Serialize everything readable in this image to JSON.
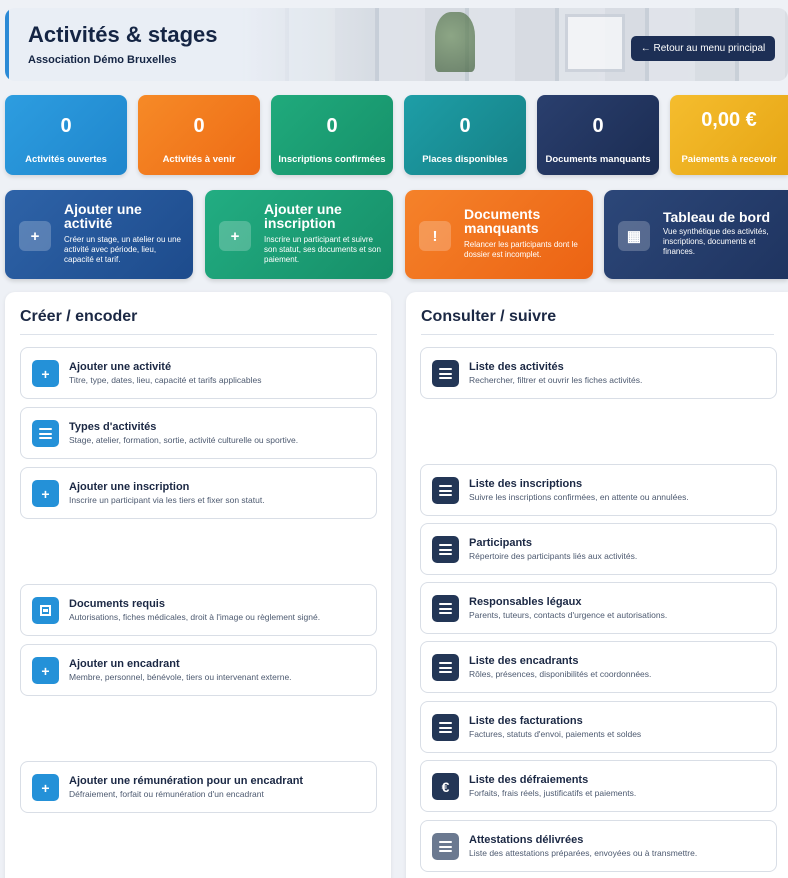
{
  "header": {
    "title": "Activités & stages",
    "subtitle": "Association Démo Bruxelles",
    "back_button": "← Retour au menu principal"
  },
  "stats": [
    {
      "value": "0",
      "label": "Activités ouvertes",
      "color": "#2d9de0"
    },
    {
      "value": "0",
      "label": "Activités à venir",
      "color": "#f68a27"
    },
    {
      "value": "0",
      "label": "Inscriptions confirmées",
      "color": "#20aa7c"
    },
    {
      "value": "0",
      "label": "Places disponibles",
      "color": "#1e9ea7"
    },
    {
      "value": "0",
      "label": "Documents manquants",
      "color": "#2a3f6e"
    },
    {
      "value": "0,00 €",
      "label": "Paiements à recevoir",
      "color": "#f5bd2e"
    }
  ],
  "actions": [
    {
      "icon": "plus-icon",
      "glyph": "+",
      "title": "Ajouter une activité",
      "desc": "Créer un stage, un atelier ou une activité avec période, lieu, capacité et tarif."
    },
    {
      "icon": "plus-icon",
      "glyph": "+",
      "title": "Ajouter une inscription",
      "desc": "Inscrire un participant et suivre son statut, ses documents et son paiement."
    },
    {
      "icon": "alert-icon",
      "glyph": "!",
      "title": "Documents manquants",
      "desc": "Relancer les participants dont le dossier est incomplet."
    },
    {
      "icon": "grid-icon",
      "glyph": "▦",
      "title": "Tableau de bord",
      "desc": "Vue synthétique des activités, inscriptions, documents et finances."
    }
  ],
  "create": {
    "heading": "Créer / encoder",
    "items": [
      {
        "icon": "plus-icon",
        "title": "Ajouter une activité",
        "desc": "Titre, type, dates, lieu, capacité et tarifs applicables"
      },
      {
        "icon": "list-icon",
        "title": "Types d'activités",
        "desc": "Stage, atelier, formation, sortie, activité culturelle ou sportive."
      },
      {
        "icon": "plus-icon",
        "title": "Ajouter une inscription",
        "desc": "Inscrire un participant via les tiers et fixer son statut."
      },
      {
        "icon": "document-icon",
        "title": "Documents requis",
        "desc": "Autorisations, fiches médicales, droit à l'image ou règlement signé."
      },
      {
        "icon": "plus-icon",
        "title": "Ajouter un encadrant",
        "desc": "Membre, personnel, bénévole, tiers ou intervenant externe."
      },
      {
        "icon": "plus-icon",
        "title": "Ajouter une rémunération pour un encadrant",
        "desc": "Défraiement, forfait ou rémunération d'un encadrant"
      }
    ]
  },
  "consult": {
    "heading": "Consulter / suivre",
    "items": [
      {
        "icon": "list-icon",
        "title": "Liste des activités",
        "desc": "Rechercher, filtrer et ouvrir les fiches activités."
      },
      {
        "icon": "list-icon",
        "title": "Liste des inscriptions",
        "desc": "Suivre les inscriptions confirmées, en attente ou annulées."
      },
      {
        "icon": "list-icon",
        "title": "Participants",
        "desc": "Répertoire des participants liés aux activités."
      },
      {
        "icon": "list-icon",
        "title": "Responsables légaux",
        "desc": "Parents, tuteurs, contacts d'urgence et autorisations."
      },
      {
        "icon": "list-icon",
        "title": "Liste des encadrants",
        "desc": "Rôles, présences, disponibilités et coordonnées."
      },
      {
        "icon": "list-icon",
        "title": "Liste des facturations",
        "desc": "Factures, statuts d'envoi, paiements et soldes"
      },
      {
        "icon": "euro-icon",
        "glyph": "€",
        "title": "Liste des défraiements",
        "desc": "Forfaits, frais réels, justificatifs et paiements."
      },
      {
        "icon": "list-icon",
        "title": "Attestations délivrées",
        "desc": "Liste des attestations préparées, envoyées ou à transmettre."
      }
    ]
  }
}
